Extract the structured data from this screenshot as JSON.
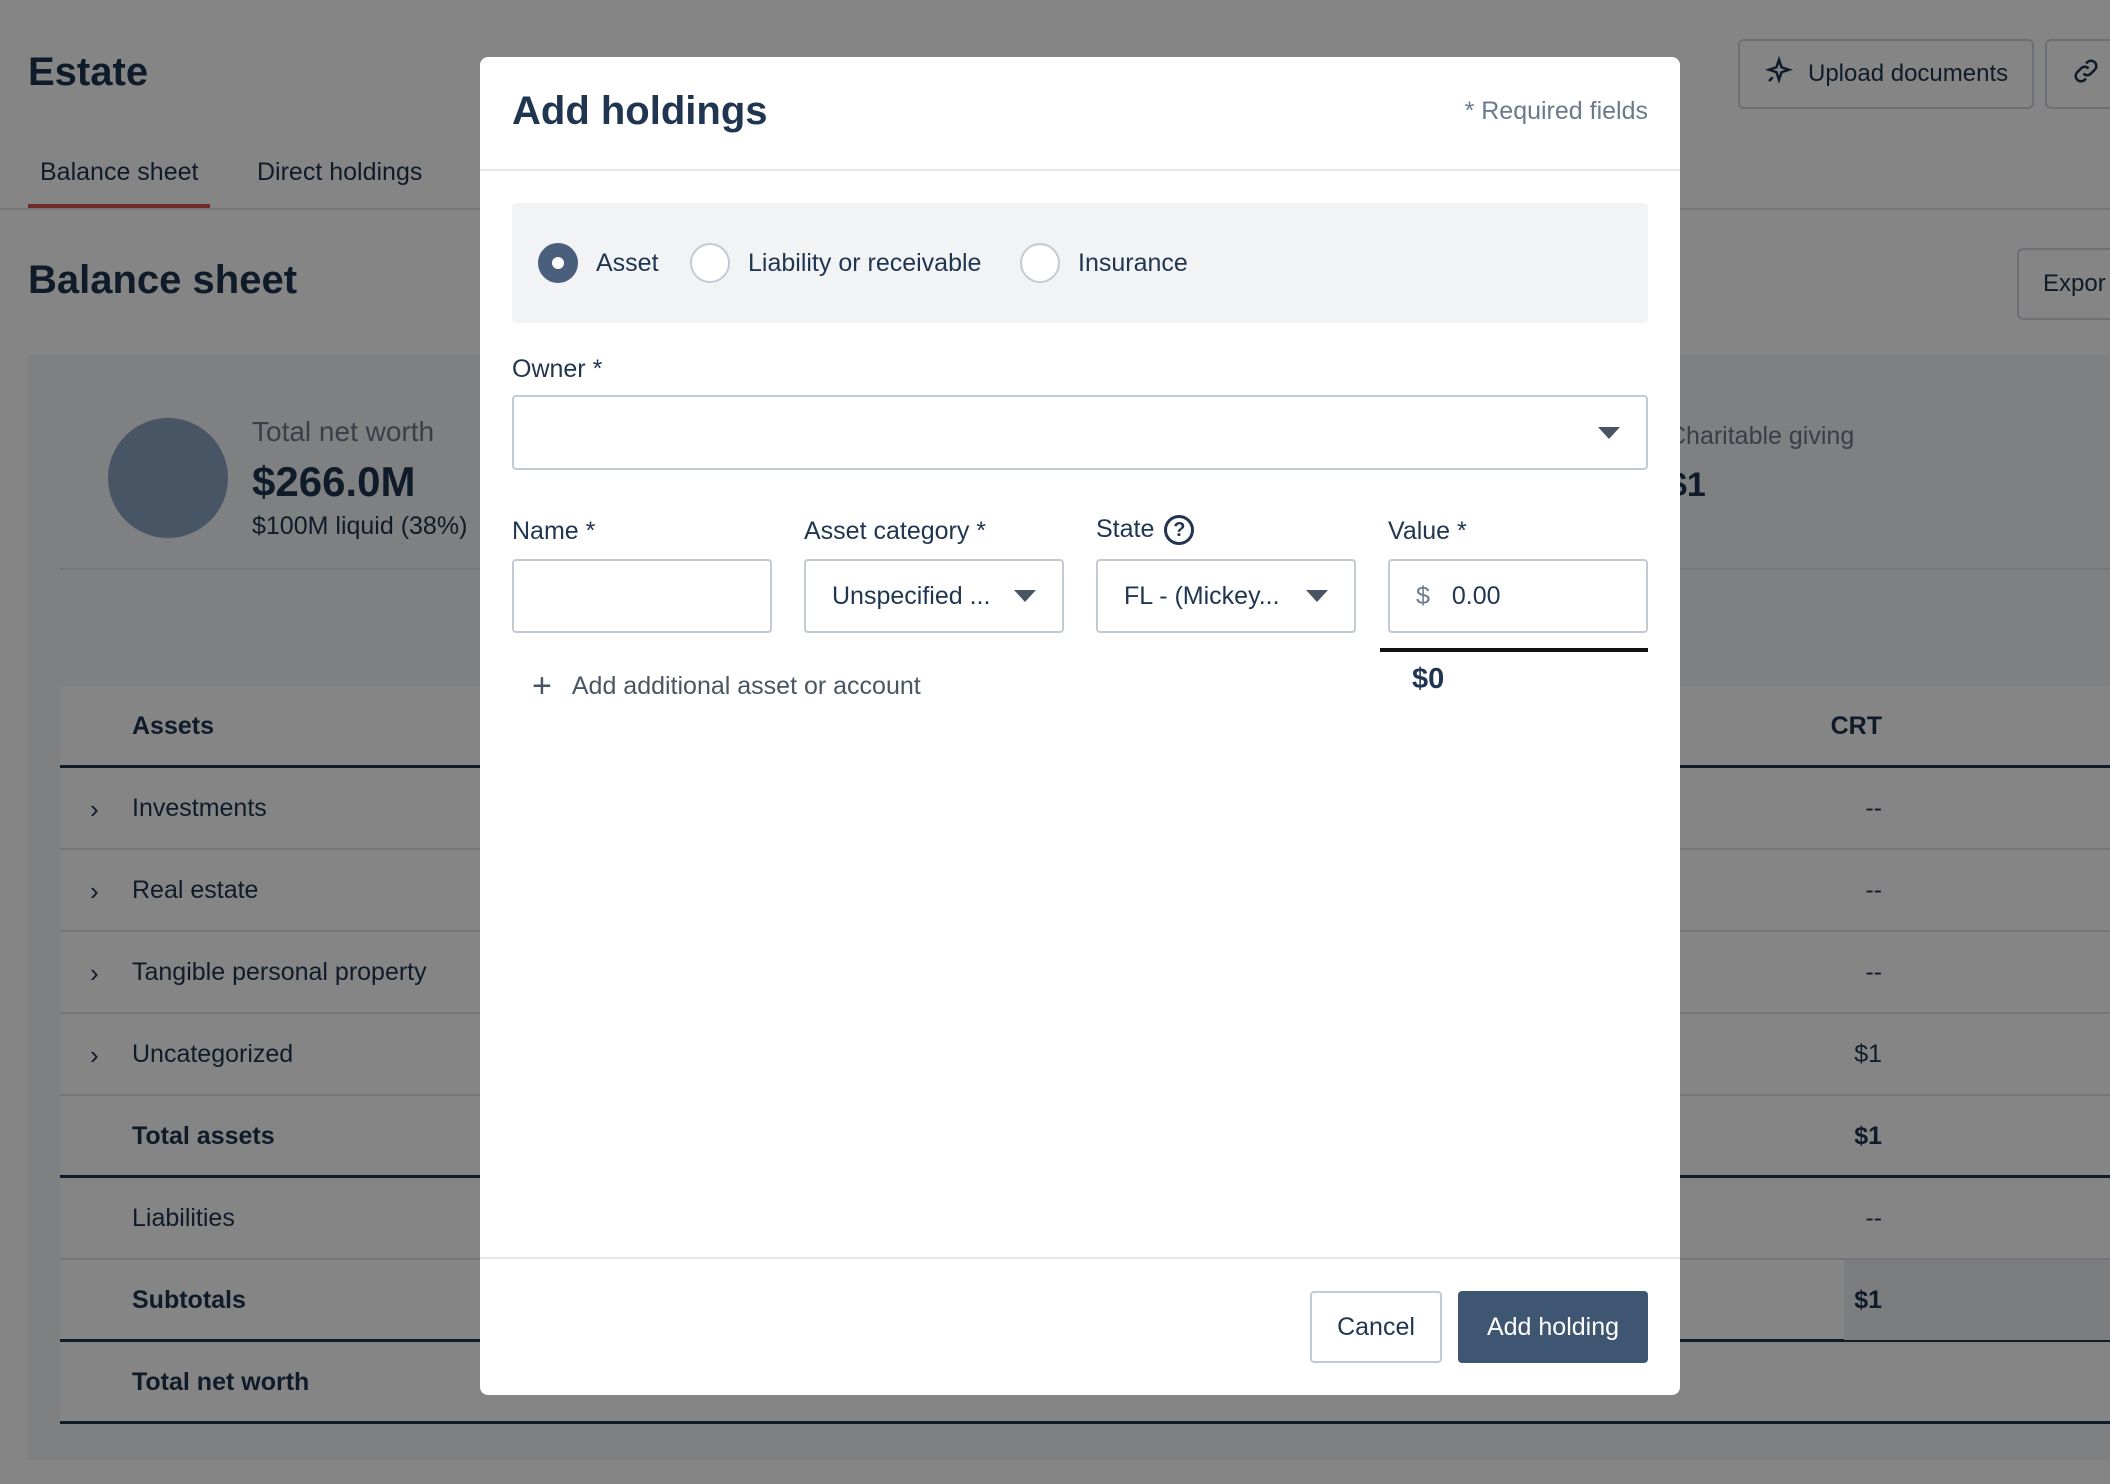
{
  "page": {
    "title": "Estate",
    "tabs": [
      {
        "label": "Balance sheet",
        "active": true
      },
      {
        "label": "Direct holdings",
        "active": false
      }
    ],
    "upload_label": "Upload documents",
    "section_title": "Balance sheet",
    "export_label": "Expor"
  },
  "summary": {
    "net_worth_label": "Total net worth",
    "net_worth_value": "$266.0M",
    "liquid": "$100M liquid (38%)",
    "charitable_label": "Charitable giving",
    "charitable_value": "$1"
  },
  "table": {
    "assets_header": "Assets",
    "crt_header": "CRT",
    "rows": [
      {
        "label": "Investments",
        "crt": "--",
        "expandable": true
      },
      {
        "label": "Real estate",
        "crt": "--",
        "expandable": true
      },
      {
        "label": "Tangible personal property",
        "crt": "--",
        "expandable": true
      },
      {
        "label": "Uncategorized",
        "crt": "$1",
        "expandable": true
      },
      {
        "label": "Total assets",
        "crt": "$1",
        "bold": true
      },
      {
        "label": "Liabilities",
        "crt": "--"
      },
      {
        "label": "Subtotals",
        "crt": "$1",
        "bold": true
      },
      {
        "label": "Total net worth",
        "crt": "",
        "bold": true
      }
    ]
  },
  "modal": {
    "title": "Add holdings",
    "required_note": "* Required fields",
    "types": [
      {
        "label": "Asset",
        "checked": true
      },
      {
        "label": "Liability or receivable",
        "checked": false
      },
      {
        "label": "Insurance",
        "checked": false
      }
    ],
    "owner_label": "Owner *",
    "owner_value": "",
    "name_label": "Name *",
    "name_value": "",
    "category_label": "Asset category *",
    "category_value": "Unspecified ...",
    "state_label": "State",
    "state_value": "FL - (Mickey...",
    "value_label": "Value *",
    "value_currency": "$",
    "value_amount": "0.00",
    "total": "$0",
    "add_additional": "Add additional asset or account",
    "cancel_label": "Cancel",
    "submit_label": "Add holding"
  },
  "colors": {
    "primary": "#3f5673",
    "tab_underline": "#d9534f",
    "text": "#1f3550"
  }
}
